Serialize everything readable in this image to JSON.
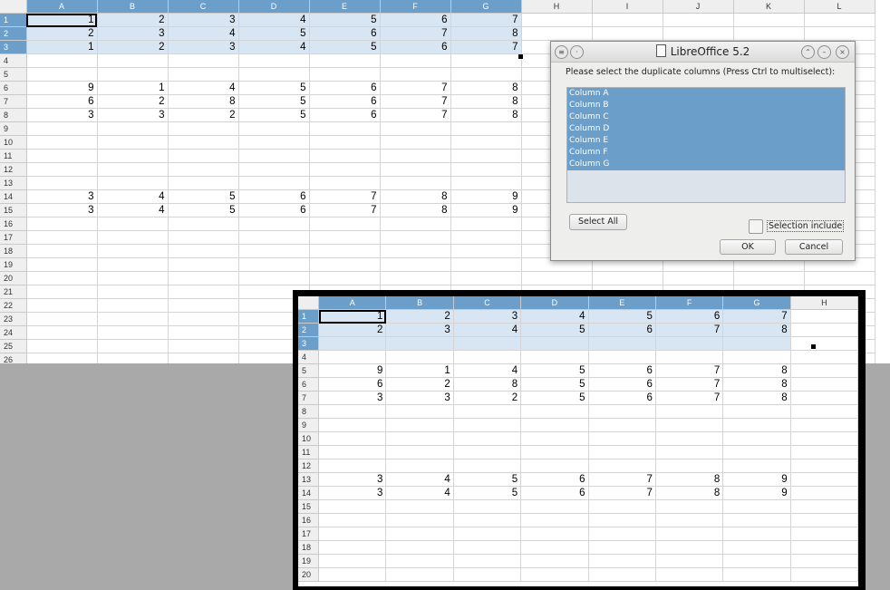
{
  "top_sheet": {
    "columns": [
      "A",
      "B",
      "C",
      "D",
      "E",
      "F",
      "G",
      "H",
      "I",
      "J",
      "K",
      "L"
    ],
    "rows": [
      {
        "n": "1",
        "cells": [
          "1",
          "2",
          "3",
          "4",
          "5",
          "6",
          "7"
        ]
      },
      {
        "n": "2",
        "cells": [
          "2",
          "3",
          "4",
          "5",
          "6",
          "7",
          "8"
        ]
      },
      {
        "n": "3",
        "cells": [
          "1",
          "2",
          "3",
          "4",
          "5",
          "6",
          "7"
        ]
      },
      {
        "n": "4",
        "cells": []
      },
      {
        "n": "5",
        "cells": []
      },
      {
        "n": "6",
        "cells": [
          "9",
          "1",
          "4",
          "5",
          "6",
          "7",
          "8"
        ]
      },
      {
        "n": "7",
        "cells": [
          "6",
          "2",
          "8",
          "5",
          "6",
          "7",
          "8"
        ]
      },
      {
        "n": "8",
        "cells": [
          "3",
          "3",
          "2",
          "5",
          "6",
          "7",
          "8"
        ]
      },
      {
        "n": "9",
        "cells": []
      },
      {
        "n": "10",
        "cells": []
      },
      {
        "n": "11",
        "cells": []
      },
      {
        "n": "12",
        "cells": []
      },
      {
        "n": "13",
        "cells": []
      },
      {
        "n": "14",
        "cells": [
          "3",
          "4",
          "5",
          "6",
          "7",
          "8",
          "9"
        ]
      },
      {
        "n": "15",
        "cells": [
          "3",
          "4",
          "5",
          "6",
          "7",
          "8",
          "9"
        ]
      },
      {
        "n": "16",
        "cells": []
      },
      {
        "n": "17",
        "cells": []
      },
      {
        "n": "18",
        "cells": []
      },
      {
        "n": "19",
        "cells": []
      },
      {
        "n": "20",
        "cells": []
      },
      {
        "n": "21",
        "cells": []
      },
      {
        "n": "22",
        "cells": []
      },
      {
        "n": "23",
        "cells": []
      },
      {
        "n": "24",
        "cells": []
      },
      {
        "n": "25",
        "cells": []
      },
      {
        "n": "26",
        "cells": []
      }
    ]
  },
  "dialog": {
    "title": "LibreOffice 5.2",
    "prompt": "Please select the duplicate columns (Press Ctrl to multiselect):",
    "columns_list": [
      "Column A",
      "Column B",
      "Column C",
      "Column D",
      "Column E",
      "Column F",
      "Column G"
    ],
    "select_all_label": "Select All",
    "selection_include_label": "Selection include",
    "ok_label": "OK",
    "cancel_label": "Cancel"
  },
  "bottom_sheet": {
    "columns": [
      "A",
      "B",
      "C",
      "D",
      "E",
      "F",
      "G",
      "H"
    ],
    "rows": [
      {
        "n": "1",
        "cells": [
          "1",
          "2",
          "3",
          "4",
          "5",
          "6",
          "7"
        ]
      },
      {
        "n": "2",
        "cells": [
          "2",
          "3",
          "4",
          "5",
          "6",
          "7",
          "8"
        ]
      },
      {
        "n": "3",
        "cells": []
      },
      {
        "n": "4",
        "cells": []
      },
      {
        "n": "5",
        "cells": [
          "9",
          "1",
          "4",
          "5",
          "6",
          "7",
          "8"
        ]
      },
      {
        "n": "6",
        "cells": [
          "6",
          "2",
          "8",
          "5",
          "6",
          "7",
          "8"
        ]
      },
      {
        "n": "7",
        "cells": [
          "3",
          "3",
          "2",
          "5",
          "6",
          "7",
          "8"
        ]
      },
      {
        "n": "8",
        "cells": []
      },
      {
        "n": "9",
        "cells": []
      },
      {
        "n": "10",
        "cells": []
      },
      {
        "n": "11",
        "cells": []
      },
      {
        "n": "12",
        "cells": []
      },
      {
        "n": "13",
        "cells": [
          "3",
          "4",
          "5",
          "6",
          "7",
          "8",
          "9"
        ]
      },
      {
        "n": "14",
        "cells": [
          "3",
          "4",
          "5",
          "6",
          "7",
          "8",
          "9"
        ]
      },
      {
        "n": "15",
        "cells": []
      },
      {
        "n": "16",
        "cells": []
      },
      {
        "n": "17",
        "cells": []
      },
      {
        "n": "18",
        "cells": []
      },
      {
        "n": "19",
        "cells": []
      },
      {
        "n": "20",
        "cells": []
      }
    ]
  },
  "colors": {
    "selection_header": "#6b9ec9",
    "selection_fill": "#d8e5f2",
    "background_gray": "#a9a9a9"
  }
}
